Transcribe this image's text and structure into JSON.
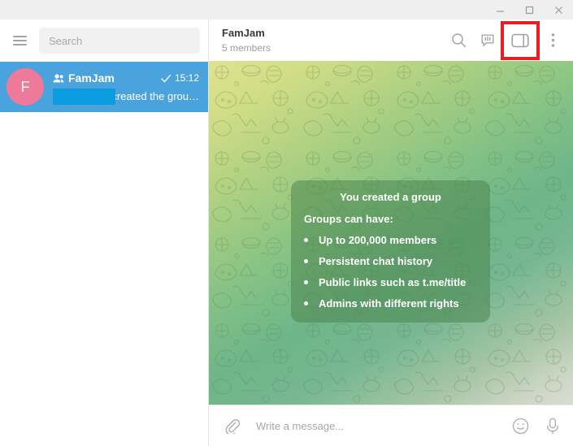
{
  "window": {
    "minimize_label": "Minimize",
    "maximize_label": "Maximize",
    "close_label": "Close"
  },
  "sidebar": {
    "menu_label": "Menu",
    "search": {
      "placeholder": "Search",
      "value": ""
    },
    "chats": [
      {
        "avatar_letter": "F",
        "avatar_color": "#ee7a9b",
        "name": "FamJam",
        "is_group": true,
        "time": "15:12",
        "read_status": "sent-check",
        "preview": "created the grou…",
        "redacted": true,
        "selected": true
      }
    ]
  },
  "chat": {
    "title": "FamJam",
    "subtitle": "5 members",
    "actions": [
      {
        "name": "search-icon",
        "label": "Search messages",
        "highlighted": false
      },
      {
        "name": "pinned-messages-icon",
        "label": "Pinned messages",
        "highlighted": false
      },
      {
        "name": "info-sidebar-toggle-icon",
        "label": "Toggle info sidebar",
        "highlighted": true
      },
      {
        "name": "more-options-icon",
        "label": "More options",
        "highlighted": false
      }
    ],
    "highlight_color": "#ee1b23",
    "message": {
      "title": "You created a group",
      "lead": "Groups can have:",
      "items": [
        "Up to 200,000 members",
        "Persistent chat history",
        "Public links such as t.me/title",
        "Admins with different rights"
      ]
    },
    "composer": {
      "attach_label": "Attach file",
      "placeholder": "Write a message...",
      "value": "",
      "emoji_label": "Emoji",
      "voice_label": "Record voice message"
    }
  }
}
